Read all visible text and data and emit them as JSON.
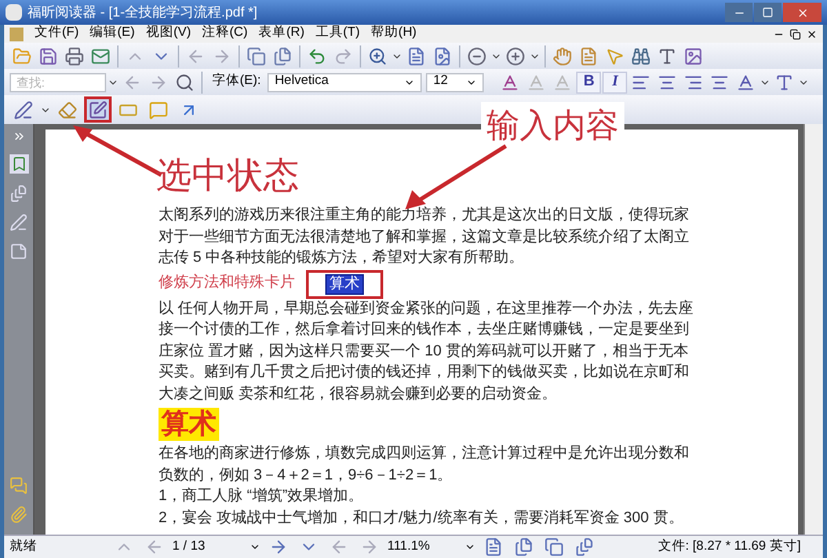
{
  "window": {
    "title": "福昕阅读器 - [1-全技能学习流程.pdf *]"
  },
  "menu": [
    "文件(F)",
    "编辑(E)",
    "视图(V)",
    "注释(C)",
    "表单(R)",
    "工具(T)",
    "帮助(H)"
  ],
  "search": {
    "placeholder": "查找:"
  },
  "font_label": "字体(E):",
  "font": {
    "value": "Helvetica"
  },
  "size": {
    "value": "12"
  },
  "format_buttons": [
    {
      "label": "B",
      "selected": false
    },
    {
      "label": "I",
      "selected": false
    }
  ],
  "annotation_tools": [
    {
      "selected": false
    },
    {
      "selected": false
    },
    {
      "selected": true
    },
    {
      "selected": false
    },
    {
      "selected": false
    },
    {
      "selected": false
    }
  ],
  "document": {
    "paragraphs": [
      {
        "kind": "text",
        "text": "太阁系列的游戏历来很注重主角的能力培养，尤其是这次出的日文版，使得玩家对于一些细节方面无法很清楚地了解和掌握，这篇文章是比较系统介绍了太阁立志传 5 中各种技能的锻炼方法，希望对大家有所帮助。"
      },
      {
        "kind": "subtitle",
        "text": "修炼方法和特殊卡片"
      },
      {
        "kind": "text",
        "text": "以 任何人物开局，早期总会碰到资金紧张的问题，在这里推荐一个办法，先去座接一个讨债的工作，然后拿着讨回来的钱作本，去坐庄赌博赚钱，一定是要坐到庄家位 置才赌，因为这样只需要买一个 10 贯的筹码就可以开赌了，相当于无本买卖。赌到有几千贯之后把讨债的钱还掉，用剩下的钱做买卖，比如说在京町和大凑之间贩 卖茶和红花，很容易就会赚到必要的启动资金。"
      },
      {
        "kind": "heading",
        "text": "算术"
      },
      {
        "kind": "text",
        "text": "在各地的商家进行修炼，填数完成四则运算，注意计算过程中是允许出现分数和负数的，例如 3－4＋2＝1，9÷6－1÷2＝1。"
      },
      {
        "kind": "text",
        "text": "1，商工人脉 “增筑”效果增加。"
      },
      {
        "kind": "text",
        "text": "2，宴会 攻城战中士气增加，和口才/魅力/统率有关，需要消耗军资金 300 贯。"
      }
    ],
    "text_box": {
      "text": "算术",
      "selected": true
    }
  },
  "callouts": [
    {
      "text": "选中状态"
    },
    {
      "text": "输入内容"
    }
  ],
  "status_bar": {
    "status": "就绪",
    "page": "1 / 13",
    "zoom": "111.1%",
    "file_size": "文件: [8.27 * 11.69 英寸]"
  }
}
